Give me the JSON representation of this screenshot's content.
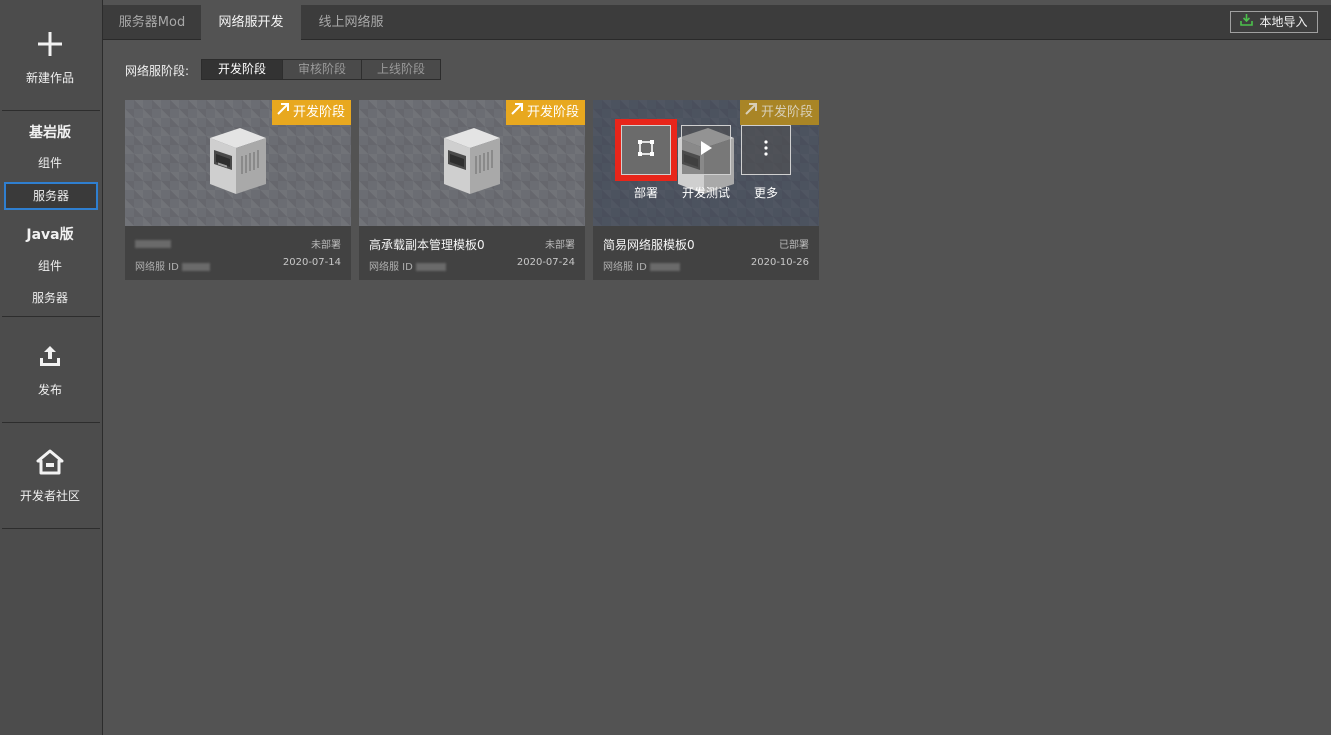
{
  "sidebar": {
    "new_work": "新建作品",
    "bedrock": {
      "title": "基岩版",
      "components": "组件",
      "servers": "服务器"
    },
    "java": {
      "title": "Java版",
      "components": "组件",
      "servers": "服务器"
    },
    "publish": "发布",
    "dev_community": "开发者社区"
  },
  "tabs": [
    "服务器Mod",
    "网络服开发",
    "线上网络服"
  ],
  "active_tab": "网络服开发",
  "import_button": "本地导入",
  "stage_filter": {
    "label": "网络服阶段:",
    "options": [
      "开发阶段",
      "审核阶段",
      "上线阶段"
    ],
    "selected": "开发阶段"
  },
  "cards": [
    {
      "title": "",
      "status": "未部署",
      "id_label": "网络服 ID ",
      "date": "2020-07-14",
      "tag": "开发阶段"
    },
    {
      "title": "高承载副本管理模板0",
      "status": "未部署",
      "id_label": "网络服 ID ",
      "date": "2020-07-24",
      "tag": "开发阶段"
    },
    {
      "title": "简易网络服模板0",
      "status": "已部署",
      "id_label": "网络服 ID ",
      "date": "2020-10-26",
      "tag": "开发阶段",
      "hover_actions": [
        "部署",
        "开发测试",
        "更多"
      ]
    }
  ],
  "colors": {
    "accent_tag": "#e8a81f",
    "highlight": "#e8251a",
    "selected_border": "#2f7fd0"
  },
  "icons": [
    "plus-icon",
    "upload-icon",
    "home-icon",
    "import-icon",
    "arrow-up-right-icon",
    "deploy-icon",
    "play-icon",
    "more-vertical-icon",
    "server-icon"
  ]
}
